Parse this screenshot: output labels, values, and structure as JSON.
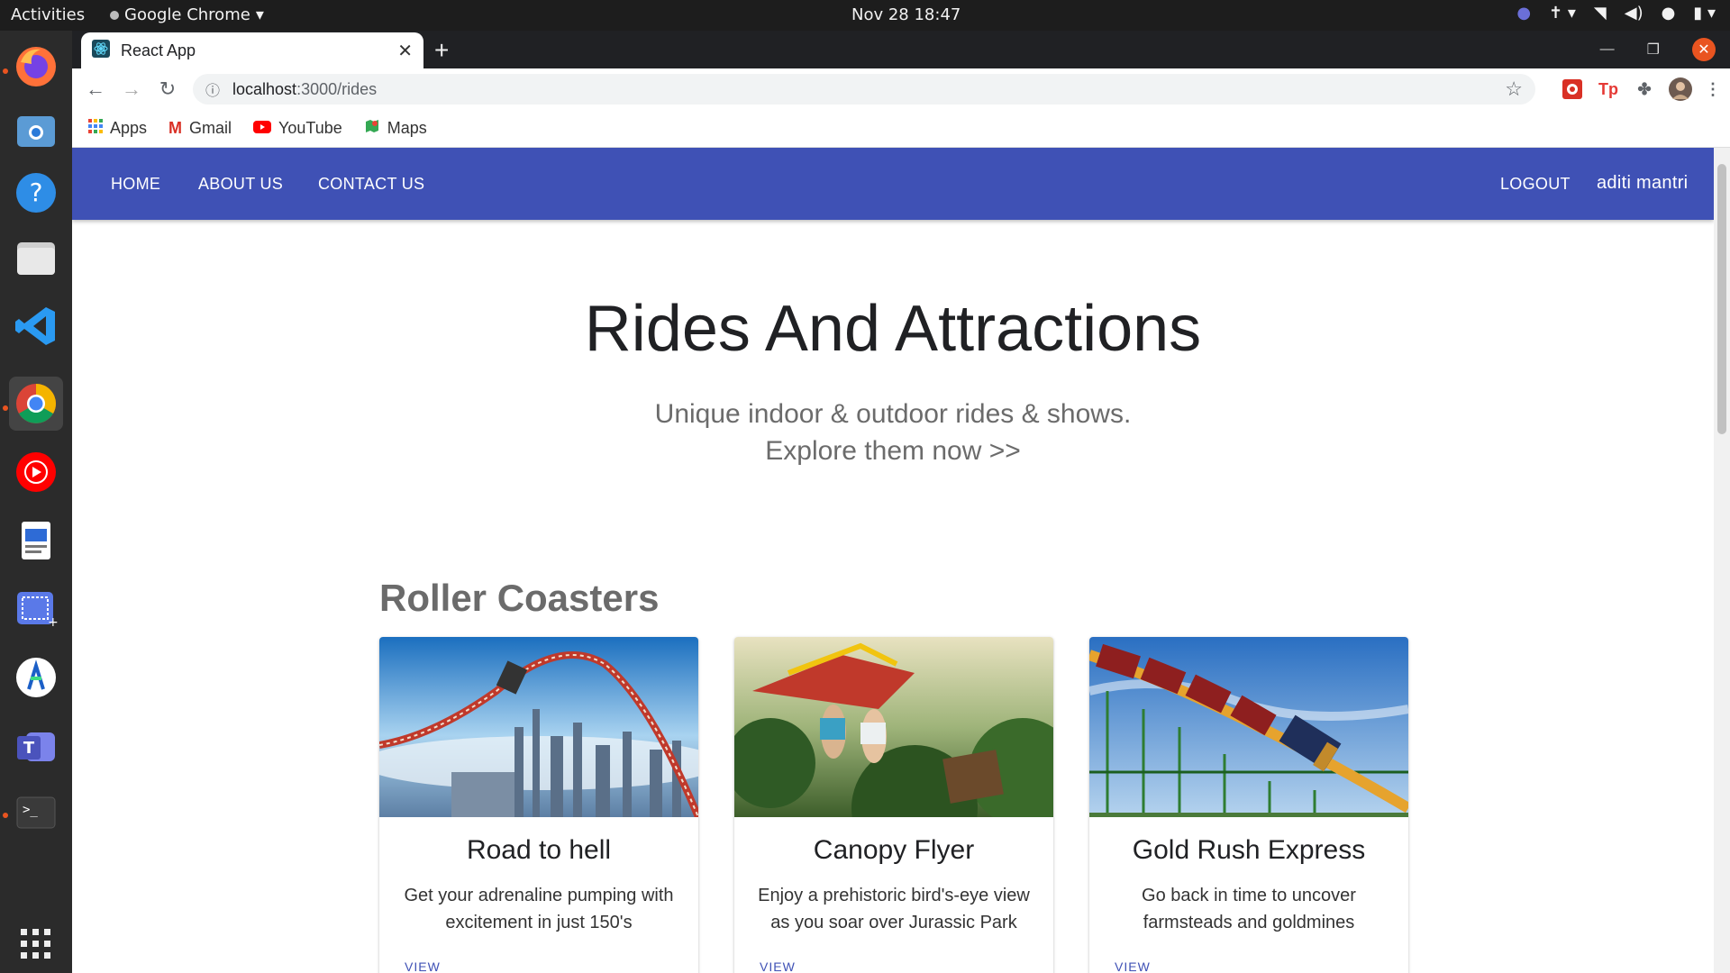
{
  "system_bar": {
    "activities": "Activities",
    "app_name": "Google Chrome",
    "clock": "Nov 28  18:47"
  },
  "dock": {
    "items": [
      "firefox-icon",
      "software-store-icon",
      "help-icon",
      "files-icon",
      "vscode-icon",
      "chrome-icon",
      "youtube-music-icon",
      "text-editor-icon",
      "screenshot-icon",
      "android-studio-icon",
      "teams-icon",
      "terminal-icon",
      "app-grid-icon"
    ]
  },
  "browser": {
    "tab_title": "React App",
    "url_host": "localhost",
    "url_path": ":3000/rides",
    "bookmarks": [
      "Apps",
      "Gmail",
      "YouTube",
      "Maps"
    ],
    "ext_tp": "Tp"
  },
  "nav": {
    "links": [
      "HOME",
      "ABOUT US",
      "CONTACT US"
    ],
    "logout": "LOGOUT",
    "user": "aditi mantri"
  },
  "hero": {
    "title": "Rides And Attractions",
    "subtitle_line1": "Unique indoor & outdoor rides & shows.",
    "subtitle_line2": "Explore them now >>"
  },
  "section": {
    "title": "Roller Coasters"
  },
  "cards": [
    {
      "title": "Road to hell",
      "desc": "Get your adrenaline pumping with excitement in just 150's",
      "action": "VIEW"
    },
    {
      "title": "Canopy Flyer",
      "desc": "Enjoy a prehistoric bird's-eye view as you soar over Jurassic Park",
      "action": "VIEW"
    },
    {
      "title": "Gold Rush Express",
      "desc": "Go back in time to uncover farmsteads and goldmines",
      "action": "VIEW"
    }
  ],
  "colors": {
    "appbar": "#3f51b5",
    "chrome_dark": "#202124",
    "dock": "#2b2b2b"
  }
}
